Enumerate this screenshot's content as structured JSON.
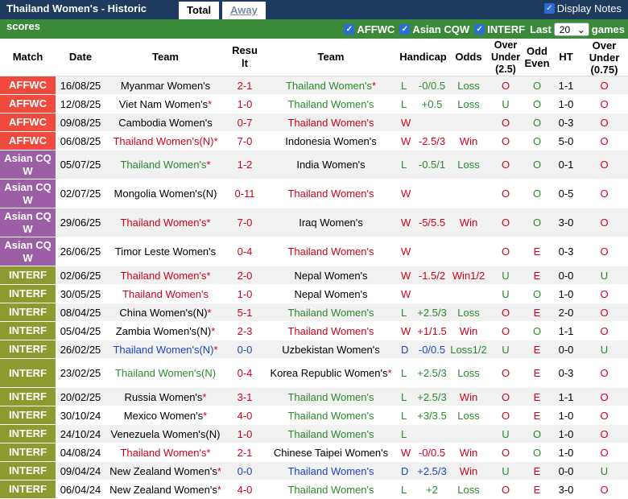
{
  "header": {
    "title": "Thailand Women's - Historic scores",
    "tabs": [
      "Total",
      "Away"
    ],
    "display_notes": "Display Notes",
    "check": "✓"
  },
  "filters": {
    "items": [
      "AFFWC",
      "Asian CQW",
      "INTERF"
    ],
    "last_label": "Last",
    "count": "20",
    "games_label": "games"
  },
  "columns": [
    "Match",
    "Date",
    "Team",
    "Result",
    "Team",
    "Handicap",
    "Odds",
    "Over Under (2.5)",
    "Odd Even",
    "HT",
    "Over Under (0.75)"
  ],
  "colors": {
    "red": "#d0021b",
    "green": "#2a8a2a",
    "blue": "#1a46c6",
    "affwc": "#f04a3e",
    "asian": "#9c5fa6",
    "interf": "#8c9a2f"
  },
  "rows": [
    {
      "match": "AFFWC",
      "date": "16/08/25",
      "home": "Myanmar Women's",
      "home_star": "",
      "home_color": "k",
      "score": "2-1",
      "away": "Thailand Women's",
      "away_star": "*",
      "away_color": "green",
      "res": "L",
      "res_color": "green",
      "hcap": "-0/0.5",
      "odds": "Loss",
      "odds_color": "green",
      "ou": "O",
      "oe": "O",
      "ht": "1-1",
      "ou2": "O"
    },
    {
      "match": "AFFWC",
      "date": "12/08/25",
      "home": "Viet Nam Women's",
      "home_star": "*",
      "home_color": "k",
      "score": "1-0",
      "away": "Thailand Women's",
      "away_star": "",
      "away_color": "green",
      "res": "L",
      "res_color": "green",
      "hcap": "+0.5",
      "odds": "Loss",
      "odds_color": "green",
      "ou": "U",
      "oe": "O",
      "ht": "1-0",
      "ou2": "O"
    },
    {
      "match": "AFFWC",
      "date": "09/08/25",
      "home": "Cambodia Women's",
      "home_star": "",
      "home_color": "k",
      "score": "0-7",
      "away": "Thailand Women's",
      "away_star": "",
      "away_color": "red",
      "res": "W",
      "res_color": "red",
      "hcap": "",
      "odds": "",
      "odds_color": "k",
      "ou": "O",
      "oe": "O",
      "ht": "0-3",
      "ou2": "O"
    },
    {
      "match": "AFFWC",
      "date": "06/08/25",
      "home": "Thailand Women's(N)",
      "home_star": "*",
      "home_color": "red",
      "score": "7-0",
      "away": "Indonesia Women's",
      "away_star": "",
      "away_color": "k",
      "res": "W",
      "res_color": "red",
      "hcap": "-2.5/3",
      "odds": "Win",
      "odds_color": "red",
      "ou": "O",
      "oe": "O",
      "ht": "5-0",
      "ou2": "O"
    },
    {
      "match": "Asian CQ W",
      "date": "05/07/25",
      "home": "Thailand Women's",
      "home_star": "*",
      "home_color": "green",
      "score": "1-2",
      "away": "India Women's",
      "away_star": "",
      "away_color": "k",
      "res": "L",
      "res_color": "green",
      "hcap": "-0.5/1",
      "odds": "Loss",
      "odds_color": "green",
      "ou": "O",
      "oe": "O",
      "ht": "0-1",
      "ou2": "O"
    },
    {
      "match": "Asian CQ W",
      "date": "02/07/25",
      "home": "Mongolia Women's(N)",
      "home_star": "",
      "home_color": "k",
      "score": "0-11",
      "away": "Thailand Women's",
      "away_star": "",
      "away_color": "red",
      "res": "W",
      "res_color": "red",
      "hcap": "",
      "odds": "",
      "odds_color": "k",
      "ou": "O",
      "oe": "O",
      "ht": "0-5",
      "ou2": "O"
    },
    {
      "match": "Asian CQ W",
      "date": "29/06/25",
      "home": "Thailand Women's",
      "home_star": "*",
      "home_color": "red",
      "score": "7-0",
      "away": "Iraq Women's",
      "away_star": "",
      "away_color": "k",
      "res": "W",
      "res_color": "red",
      "hcap": "-5/5.5",
      "odds": "Win",
      "odds_color": "red",
      "ou": "O",
      "oe": "O",
      "ht": "3-0",
      "ou2": "O"
    },
    {
      "match": "Asian CQ W",
      "date": "26/06/25",
      "home": "Timor Leste Women's",
      "home_star": "",
      "home_color": "k",
      "score": "0-4",
      "away": "Thailand Women's",
      "away_star": "",
      "away_color": "red",
      "res": "W",
      "res_color": "red",
      "hcap": "",
      "odds": "",
      "odds_color": "k",
      "ou": "O",
      "oe": "E",
      "ht": "0-3",
      "ou2": "O"
    },
    {
      "match": "INTERF",
      "date": "02/06/25",
      "home": "Thailand Women's",
      "home_star": "*",
      "home_color": "red",
      "score": "2-0",
      "away": "Nepal Women's",
      "away_star": "",
      "away_color": "k",
      "res": "W",
      "res_color": "red",
      "hcap": "-1.5/2",
      "odds": "Win1/2",
      "odds_color": "red",
      "ou": "U",
      "oe": "E",
      "ht": "0-0",
      "ou2": "U"
    },
    {
      "match": "INTERF",
      "date": "30/05/25",
      "home": "Thailand Women's",
      "home_star": "",
      "home_color": "red",
      "score": "1-0",
      "away": "Nepal Women's",
      "away_star": "",
      "away_color": "k",
      "res": "W",
      "res_color": "red",
      "hcap": "",
      "odds": "",
      "odds_color": "k",
      "ou": "U",
      "oe": "O",
      "ht": "1-0",
      "ou2": "O"
    },
    {
      "match": "INTERF",
      "date": "08/04/25",
      "home": "China Women's(N)",
      "home_star": "*",
      "home_color": "k",
      "score": "5-1",
      "away": "Thailand Women's",
      "away_star": "",
      "away_color": "green",
      "res": "L",
      "res_color": "green",
      "hcap": "+2.5/3",
      "odds": "Loss",
      "odds_color": "green",
      "ou": "O",
      "oe": "E",
      "ht": "2-0",
      "ou2": "O"
    },
    {
      "match": "INTERF",
      "date": "05/04/25",
      "home": "Zambia Women's(N)",
      "home_star": "*",
      "home_color": "k",
      "score": "2-3",
      "away": "Thailand Women's",
      "away_star": "",
      "away_color": "red",
      "res": "W",
      "res_color": "red",
      "hcap": "+1/1.5",
      "odds": "Win",
      "odds_color": "red",
      "ou": "O",
      "oe": "O",
      "ht": "1-1",
      "ou2": "O"
    },
    {
      "match": "INTERF",
      "date": "26/02/25",
      "home": "Thailand Women's(N)",
      "home_star": "*",
      "home_color": "blue",
      "score": "0-0",
      "away": "Uzbekistan Women's",
      "away_star": "",
      "away_color": "k",
      "res": "D",
      "res_color": "blue",
      "hcap": "-0/0.5",
      "odds": "Loss1/2",
      "odds_color": "green",
      "ou": "U",
      "oe": "E",
      "ht": "0-0",
      "ou2": "U"
    },
    {
      "match": "INTERF",
      "date": "23/02/25",
      "home": "Thailand Women's(N)",
      "home_star": "",
      "home_color": "green",
      "score": "0-4",
      "away": "Korea Republic Women's",
      "away_star": "*",
      "away_color": "k",
      "res": "L",
      "res_color": "green",
      "hcap": "+2.5/3",
      "odds": "Loss",
      "odds_color": "green",
      "ou": "O",
      "oe": "E",
      "ht": "0-3",
      "ou2": "O",
      "tall": true
    },
    {
      "match": "INTERF",
      "date": "20/02/25",
      "home": "Russia Women's",
      "home_star": "*",
      "home_color": "k",
      "score": "3-1",
      "away": "Thailand Women's",
      "away_star": "",
      "away_color": "green",
      "res": "L",
      "res_color": "green",
      "hcap": "+2.5/3",
      "odds": "Win",
      "odds_color": "red",
      "ou": "O",
      "oe": "E",
      "ht": "1-1",
      "ou2": "O"
    },
    {
      "match": "INTERF",
      "date": "30/10/24",
      "home": "Mexico Women's",
      "home_star": "*",
      "home_color": "k",
      "score": "4-0",
      "away": "Thailand Women's",
      "away_star": "",
      "away_color": "green",
      "res": "L",
      "res_color": "green",
      "hcap": "+3/3.5",
      "odds": "Loss",
      "odds_color": "green",
      "ou": "O",
      "oe": "E",
      "ht": "1-0",
      "ou2": "O"
    },
    {
      "match": "INTERF",
      "date": "24/10/24",
      "home": "Venezuela Women's(N)",
      "home_star": "",
      "home_color": "k",
      "score": "1-0",
      "away": "Thailand Women's",
      "away_star": "",
      "away_color": "green",
      "res": "L",
      "res_color": "green",
      "hcap": "",
      "odds": "",
      "odds_color": "k",
      "ou": "U",
      "oe": "O",
      "ht": "1-0",
      "ou2": "O"
    },
    {
      "match": "INTERF",
      "date": "04/08/24",
      "home": "Thailand Women's",
      "home_star": "*",
      "home_color": "red",
      "score": "2-1",
      "away": "Chinese Taipei Women's",
      "away_star": "",
      "away_color": "k",
      "res": "W",
      "res_color": "red",
      "hcap": "-0/0.5",
      "odds": "Win",
      "odds_color": "red",
      "ou": "O",
      "oe": "O",
      "ht": "1-0",
      "ou2": "O"
    },
    {
      "match": "INTERF",
      "date": "09/04/24",
      "home": "New Zealand Women's",
      "home_star": "*",
      "home_color": "k",
      "score": "0-0",
      "away": "Thailand Women's",
      "away_star": "",
      "away_color": "blue",
      "res": "D",
      "res_color": "blue",
      "hcap": "+2.5/3",
      "odds": "Win",
      "odds_color": "red",
      "ou": "U",
      "oe": "E",
      "ht": "0-0",
      "ou2": "U"
    },
    {
      "match": "INTERF",
      "date": "06/04/24",
      "home": "New Zealand Women's",
      "home_star": "*",
      "home_color": "k",
      "score": "4-0",
      "away": "Thailand Women's",
      "away_star": "",
      "away_color": "green",
      "res": "L",
      "res_color": "green",
      "hcap": "+2",
      "odds": "Loss",
      "odds_color": "green",
      "ou": "O",
      "oe": "E",
      "ht": "3-0",
      "ou2": "O"
    }
  ]
}
